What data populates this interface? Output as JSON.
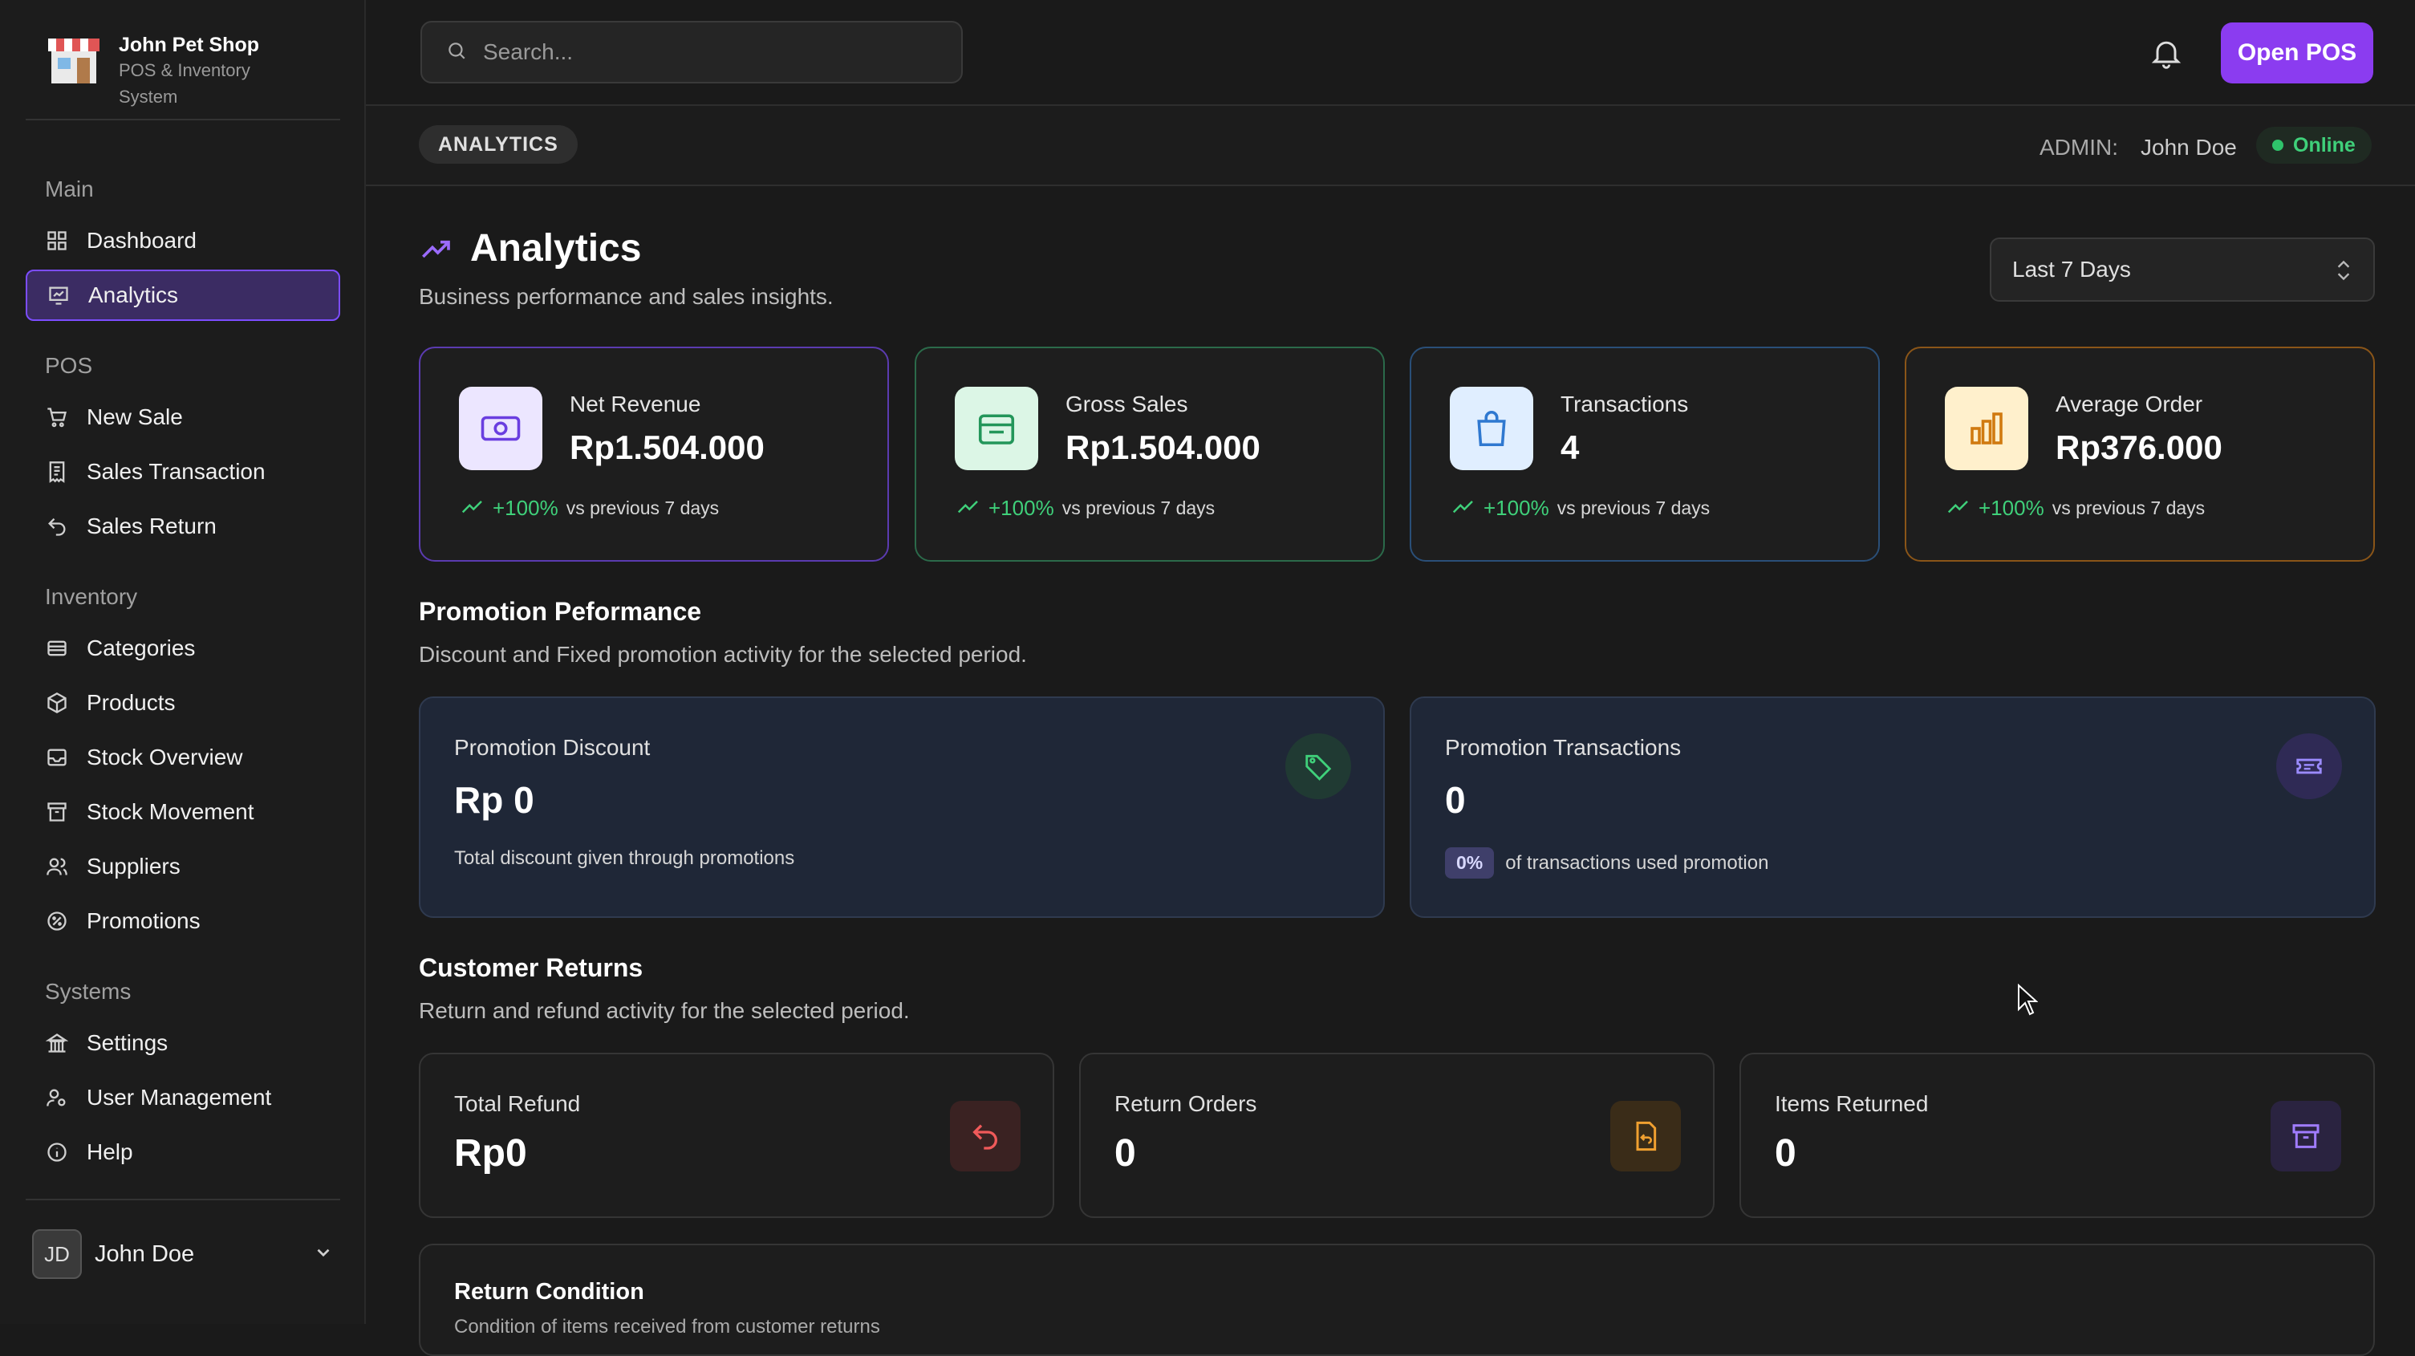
{
  "brand": {
    "name": "John Pet Shop",
    "subtitle": "POS & Inventory System"
  },
  "sidebar": {
    "sections": [
      {
        "label": "Main"
      },
      {
        "label": "POS"
      },
      {
        "label": "Inventory"
      },
      {
        "label": "Systems"
      }
    ],
    "items": [
      {
        "label": "Dashboard",
        "icon": "grid-icon"
      },
      {
        "label": "Analytics",
        "icon": "chart-icon",
        "active": true
      },
      {
        "label": "New Sale",
        "icon": "cart-icon"
      },
      {
        "label": "Sales Transaction",
        "icon": "receipt-icon"
      },
      {
        "label": "Sales Return",
        "icon": "undo-icon"
      },
      {
        "label": "Categories",
        "icon": "layers-icon"
      },
      {
        "label": "Products",
        "icon": "box-icon"
      },
      {
        "label": "Stock Overview",
        "icon": "inbox-icon"
      },
      {
        "label": "Stock Movement",
        "icon": "archive-icon"
      },
      {
        "label": "Suppliers",
        "icon": "users-icon"
      },
      {
        "label": "Promotions",
        "icon": "percent-icon"
      },
      {
        "label": "Settings",
        "icon": "building-icon"
      },
      {
        "label": "User Management",
        "icon": "user-cog-icon"
      },
      {
        "label": "Help",
        "icon": "info-icon"
      }
    ],
    "user": {
      "initials": "JD",
      "name": "John Doe"
    }
  },
  "topbar": {
    "search_placeholder": "Search...",
    "open_pos_label": "Open POS"
  },
  "subbar": {
    "breadcrumb": "ANALYTICS",
    "admin_label": "ADMIN:",
    "admin_name": "John Doe",
    "status": "Online"
  },
  "header": {
    "title": "Analytics",
    "subtitle": "Business performance and sales insights.",
    "range_selected": "Last 7 Days"
  },
  "kpis": [
    {
      "label": "Net Revenue",
      "value": "Rp1.504.000",
      "change": "+100%",
      "change_note": "vs previous 7 days",
      "color": "#7c4dff"
    },
    {
      "label": "Gross Sales",
      "value": "Rp1.504.000",
      "change": "+100%",
      "change_note": "vs previous 7 days",
      "color": "#2e8c5a"
    },
    {
      "label": "Transactions",
      "value": "4",
      "change": "+100%",
      "change_note": "vs previous 7 days",
      "color": "#2b5f8f"
    },
    {
      "label": "Average Order",
      "value": "Rp376.000",
      "change": "+100%",
      "change_note": "vs previous 7 days",
      "color": "#b86a12"
    }
  ],
  "promotion": {
    "title": "Promotion Peformance",
    "subtitle": "Discount and Fixed promotion activity for the selected period.",
    "discount": {
      "label": "Promotion Discount",
      "value": "Rp 0",
      "note": "Total discount given through promotions"
    },
    "transactions": {
      "label": "Promotion Transactions",
      "value": "0",
      "badge": "0%",
      "note": "of transactions used promotion"
    }
  },
  "returns": {
    "title": "Customer Returns",
    "subtitle": "Return and refund activity for the selected period.",
    "cards": [
      {
        "label": "Total Refund",
        "value": "Rp0"
      },
      {
        "label": "Return Orders",
        "value": "0"
      },
      {
        "label": "Items Returned",
        "value": "0"
      }
    ]
  },
  "condition": {
    "title": "Return Condition",
    "subtitle": "Condition of items received from customer returns"
  }
}
